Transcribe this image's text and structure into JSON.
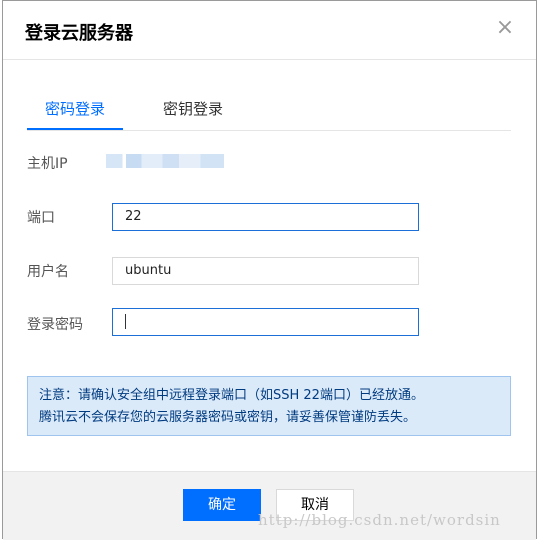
{
  "dialog": {
    "title": "登录云服务器",
    "close_glyph": "×"
  },
  "tabs": [
    {
      "label": "密码登录",
      "active": true
    },
    {
      "label": "密钥登录",
      "active": false
    }
  ],
  "form": {
    "host": {
      "label": "主机IP"
    },
    "port": {
      "label": "端口",
      "value": "22"
    },
    "username": {
      "label": "用户名",
      "value": "ubuntu"
    },
    "password": {
      "label": "登录密码",
      "value": ""
    }
  },
  "notice": {
    "line1": "注意：请确认安全组中远程登录端口（如SSH 22端口）已经放通。",
    "line2": "腾讯云不会保存您的云服务器密码或密钥，请妥善保管谨防丢失。"
  },
  "footer": {
    "confirm_label": "确定",
    "cancel_label": "取消"
  },
  "watermark": {
    "text": "http://blog.csdn.net/wordsin"
  },
  "colors": {
    "accent": "#006eff",
    "notice_bg": "#dbeaf9",
    "notice_text": "#003b80"
  },
  "icons": {
    "close": "close-icon",
    "caret": "text-caret"
  }
}
